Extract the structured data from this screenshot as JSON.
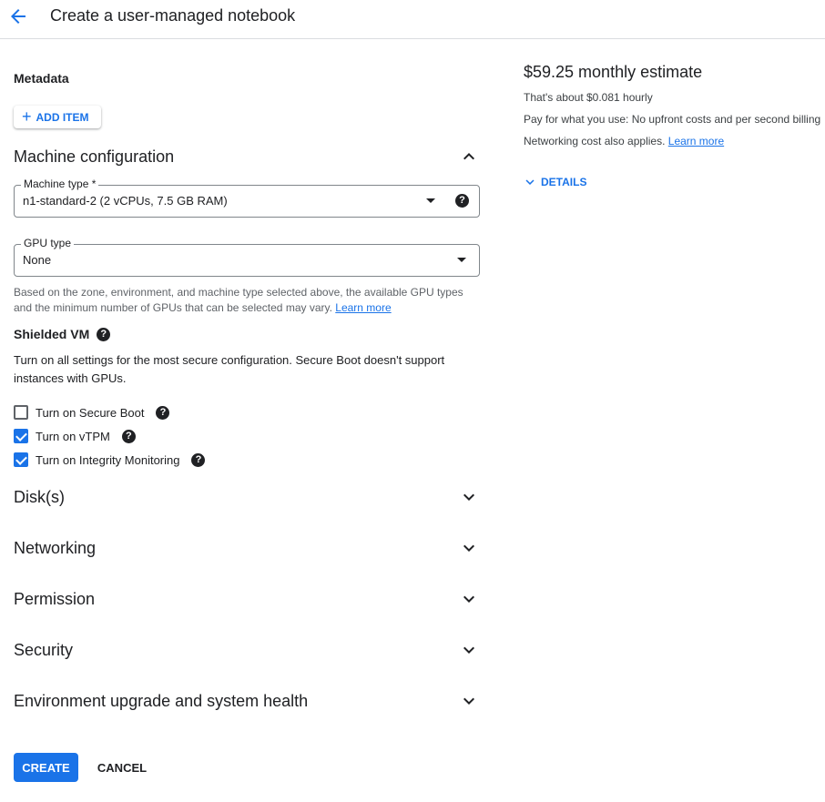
{
  "header": {
    "title": "Create a user-managed notebook",
    "back_icon": "arrow-back-icon"
  },
  "metadata": {
    "title": "Metadata",
    "add_item_label": "ADD ITEM"
  },
  "machine_configuration": {
    "title": "Machine configuration",
    "machine_type": {
      "label": "Machine type *",
      "value": "n1-standard-2 (2 vCPUs, 7.5 GB RAM)"
    },
    "gpu_type": {
      "label": "GPU type",
      "value": "None"
    },
    "hint_text": "Based on the zone, environment, and machine type selected above, the available GPU types and the minimum number of GPUs that can be selected may vary.",
    "hint_link": "Learn more"
  },
  "shielded_vm": {
    "title": "Shielded VM",
    "description": "Turn on all settings for the most secure configuration. Secure Boot doesn't support instances with GPUs.",
    "options": [
      {
        "label": "Turn on Secure Boot",
        "checked": false
      },
      {
        "label": "Turn on vTPM",
        "checked": true
      },
      {
        "label": "Turn on Integrity Monitoring",
        "checked": true
      }
    ]
  },
  "sections": [
    {
      "title": "Disk(s)"
    },
    {
      "title": "Networking"
    },
    {
      "title": "Permission"
    },
    {
      "title": "Security"
    },
    {
      "title": "Environment upgrade and system health"
    }
  ],
  "actions": {
    "create_label": "CREATE",
    "cancel_label": "CANCEL"
  },
  "pricing": {
    "estimate": "$59.25 monthly estimate",
    "hourly": "That's about $0.081 hourly",
    "pay_text": "Pay for what you use: No upfront costs and per second billing",
    "network_text": "Networking cost also applies.",
    "network_link": "Learn more",
    "details_label": "DETAILS"
  },
  "colors": {
    "accent": "#1a73e8",
    "text": "#202124",
    "muted": "#5f6368",
    "divider": "#dadce0"
  }
}
